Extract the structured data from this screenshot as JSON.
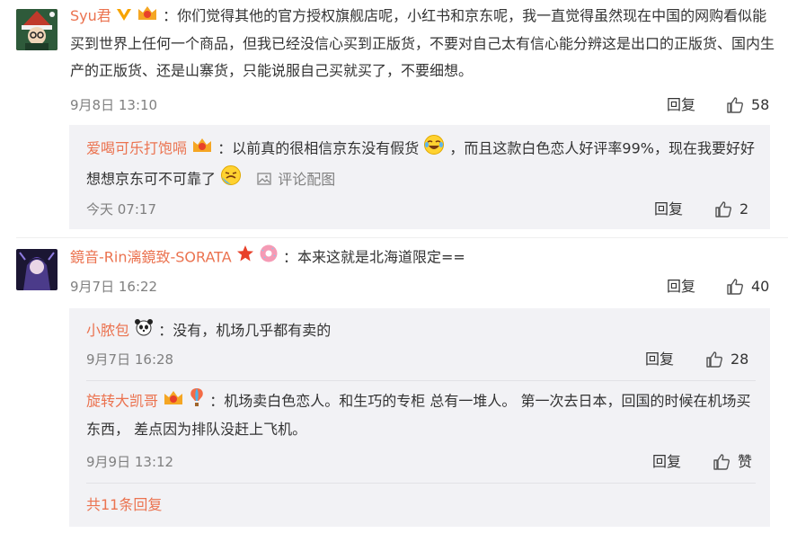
{
  "comments": [
    {
      "username": "Syu君",
      "text": "：你们觉得其他的官方授权旗舰店呢，小红书和京东呢，我一直觉得虽然现在中国的网购看似能买到世界上任何一个商品，但我已经没信心买到正版货，不要对自己太有信心能分辨这是出口的正版货、国内生产的正版货、还是山寨货，只能说服自己买就买了，不要细想。",
      "time": "9月8日 13:10",
      "reply_label": "回复",
      "likes": "58",
      "replies": [
        {
          "username": "爱喝可乐打饱嗝",
          "text_part1": "：以前真的很相信京东没有假货",
          "text_part2": "，而且这款白色恋人好评率99%，现在我要好好想想京东可不可靠了",
          "pic_label": "评论配图",
          "time": "今天 07:17",
          "reply_label": "回复",
          "likes": "2"
        }
      ]
    },
    {
      "username": "鏡音-Rin漓鏡致-SORATA",
      "text": "：本来这就是北海道限定==",
      "time": "9月7日 16:22",
      "reply_label": "回复",
      "likes": "40",
      "replies": [
        {
          "username": "小脓包",
          "text": "：没有，机场几乎都有卖的",
          "time": "9月7日 16:28",
          "reply_label": "回复",
          "likes": "28"
        },
        {
          "username": "旋转大凯哥",
          "text": "：机场卖白色恋人。和生巧的专柜 总有一堆人。 第一次去日本，回国的时候在机场买东西， 差点因为排队没赶上飞机。",
          "time": "9月9日 13:12",
          "reply_label": "回复",
          "likes": "赞"
        }
      ],
      "more_label": "共11条回复"
    }
  ],
  "colors": {
    "username": "#eb7350",
    "meta": "#808080",
    "sub_bg": "#f2f2f5"
  }
}
